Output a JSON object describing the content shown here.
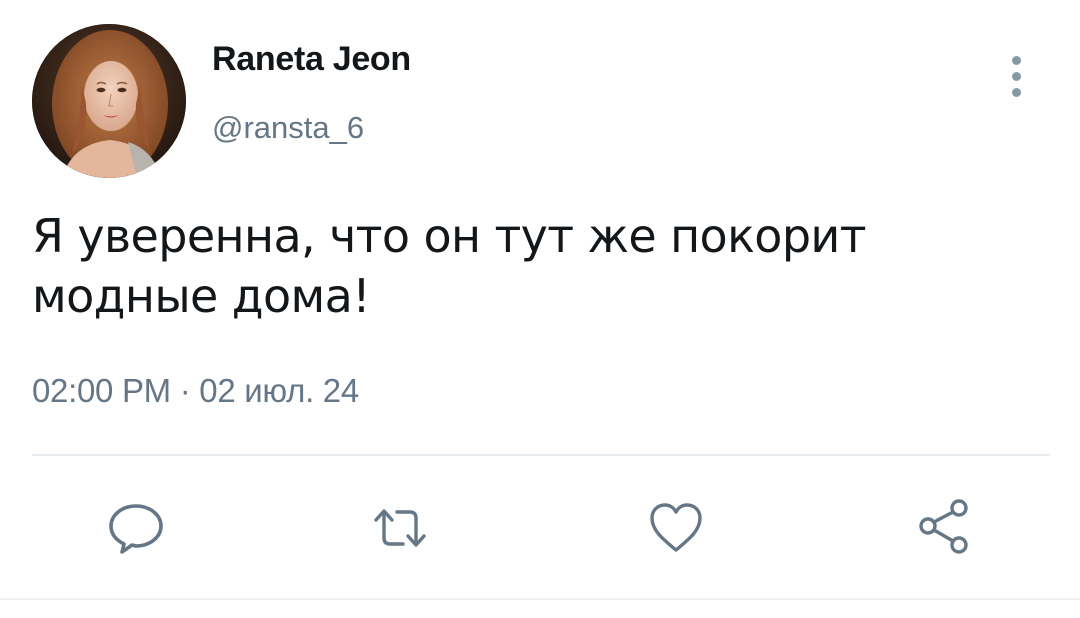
{
  "tweet": {
    "author": {
      "display_name": "Raneta Jeon",
      "handle": "@ransta_6"
    },
    "text_line1": "Я уверенна, что он тут же покорит",
    "text_line2": "модные дома!",
    "timestamp": "02:00 PM · 02 июл. 24"
  },
  "actions": {
    "reply_icon": "speech-bubble-icon",
    "retweet_icon": "retweet-arrows-icon",
    "like_icon": "heart-icon",
    "share_icon": "share-nodes-icon"
  },
  "menu_icon": "vertical-ellipsis-icon",
  "colors": {
    "text_primary": "#14171a",
    "text_secondary": "#657786",
    "icon": "#657786",
    "divider": "#e6ecf0"
  }
}
